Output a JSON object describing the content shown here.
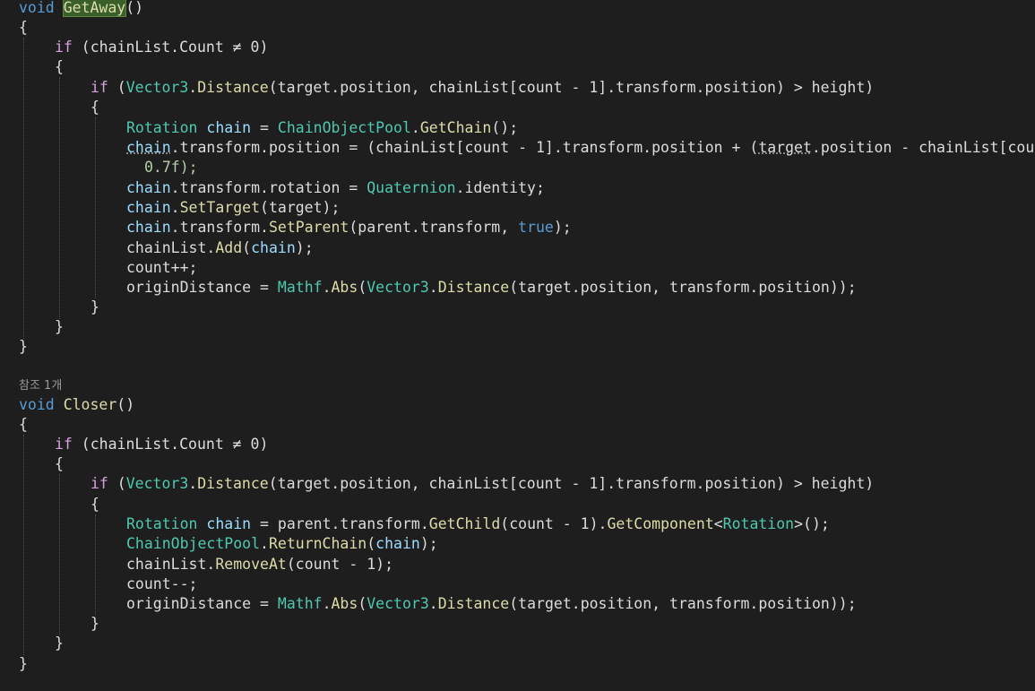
{
  "codelens": {
    "closer_refs": "참조 1개"
  },
  "code": {
    "m1_sig_kw": "void",
    "m1_sig_name": "GetAway",
    "m1_sig_parens": "()",
    "open_brace": "{",
    "close_brace": "}",
    "if_kw": "if",
    "outer_if_cond": " (chainList.Count ≠ 0)",
    "inner_if_open": " (",
    "vector3": "Vector3",
    "distance": "Distance",
    "inner_if_args": "(target.position, chainList[count - 1].transform.position) > height)",
    "dot": ".",
    "ga_l1_type": "Rotation",
    "ga_l1_var": "chain",
    "ga_l1_eq": " = ",
    "pool": "ChainObjectPool",
    "get_chain": "GetChain",
    "ga_l1_end": "();",
    "ga_l2_var": "chain",
    "ga_l2_a": ".transform.position = (chainList[count - 1].transform.position + (",
    "ga_l2_target": "target",
    "ga_l2_b": ".position - chainList[cou",
    "ga_l2_cont": "0.7f);",
    "ga_l3_var": "chain",
    "ga_l3_a": ".transform.rotation = ",
    "quaternion": "Quaternion",
    "ga_l3_b": ".identity;",
    "ga_l4_var": "chain",
    "set_target": "SetTarget",
    "ga_l4_b": "(target);",
    "ga_l5_var": "chain",
    "ga_l5_a": ".transform.",
    "set_parent": "SetParent",
    "ga_l5_b": "(parent.transform, ",
    "true_kw": "true",
    "ga_l5_c": ");",
    "ga_l6_a": "chainList.",
    "add": "Add",
    "ga_l6_b": "(",
    "ga_l6_var": "chain",
    "ga_l6_c": ");",
    "ga_l7": "count++;",
    "origin_a": "originDistance = ",
    "mathf": "Mathf",
    "abs": "Abs",
    "paren": "(",
    "origin_b": "(target.position, transform.position));",
    "m2_sig_kw": "void",
    "m2_sig_name": "Closer",
    "m2_sig_parens": "()",
    "cl_l1_type": "Rotation",
    "cl_l1_var": "chain",
    "cl_l1_a": " = parent.transform.",
    "get_child": "GetChild",
    "cl_l1_b": "(count - 1).",
    "get_component": "GetComponent",
    "lt": "<",
    "rotation_generic": "Rotation",
    "cl_l1_c": ">();",
    "return_chain": "ReturnChain",
    "cl_l2_var": "chain",
    "cl_l2_c": ");",
    "cl_l3_a": "chainList.",
    "remove_at": "RemoveAt",
    "cl_l3_b": "(count - 1);",
    "cl_l4": "count--;"
  }
}
